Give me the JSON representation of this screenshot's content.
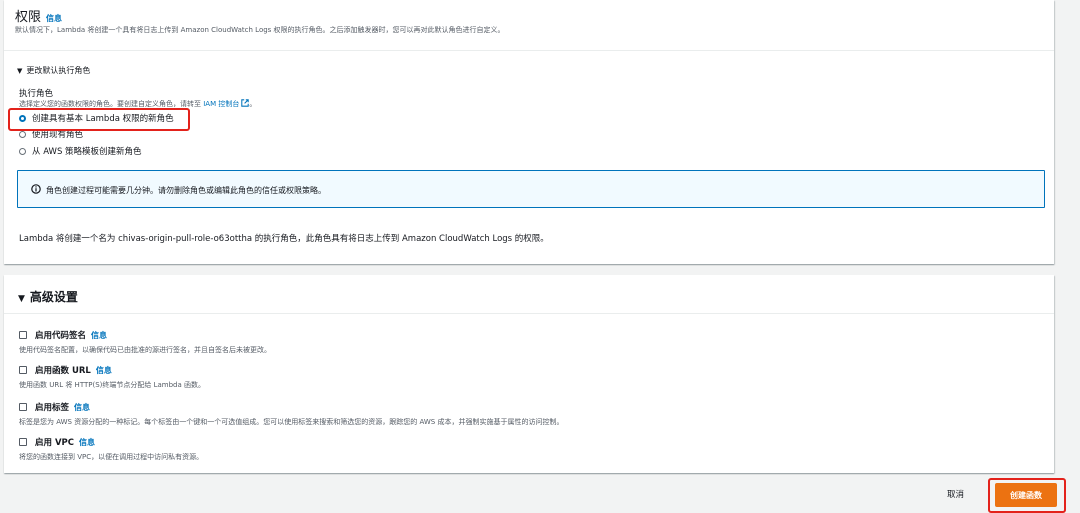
{
  "permissions": {
    "title": "权限",
    "info": "信息",
    "description": "默认情况下，Lambda 将创建一个具有将日志上传到 Amazon CloudWatch Logs 权限的执行角色。之后添加触发器时，您可以再对此默认角色进行自定义。",
    "change_role_toggle": "更改默认执行角色",
    "exec_role_label": "执行角色",
    "exec_role_desc": "选择定义您的函数权限的角色。要创建自定义角色，请转至",
    "iam_link": "IAM 控制台",
    "period": "。",
    "options": [
      {
        "label": "创建具有基本 Lambda 权限的新角色",
        "selected": true
      },
      {
        "label": "使用现有角色",
        "selected": false
      },
      {
        "label": "从 AWS 策略模板创建新角色",
        "selected": false
      }
    ],
    "alert": "角色创建过程可能需要几分钟。请勿删除角色或编辑此角色的信任或权限策略。",
    "note": "Lambda 将创建一个名为 chivas-origin-pull-role-o63ottha 的执行角色，此角色具有将日志上传到 Amazon CloudWatch Logs 的权限。"
  },
  "advanced": {
    "title": "高级设置",
    "items": [
      {
        "label": "启用代码签名",
        "info": "信息",
        "desc": "使用代码签名配置，以确保代码已由批准的源进行签名，并且自签名后未被更改。",
        "checked": false
      },
      {
        "label": "启用函数 URL",
        "info": "信息",
        "desc": "使用函数 URL 将 HTTP(S)终端节点分配给 Lambda 函数。",
        "checked": false
      },
      {
        "label": "启用标签",
        "info": "信息",
        "desc": "标签是您为 AWS 资源分配的一种标记。每个标签由一个键和一个可选值组成。您可以使用标签来搜索和筛选您的资源，跟踪您的 AWS 成本，并强制实施基于属性的访问控制。",
        "checked": false
      },
      {
        "label": "启用 VPC",
        "info": "信息",
        "desc": "将您的函数连接到 VPC，以便在调用过程中访问私有资源。",
        "checked": false
      }
    ]
  },
  "footer": {
    "cancel": "取消",
    "create": "创建函数"
  },
  "colors": {
    "accent": "#0073bb",
    "primary_button": "#ec7211",
    "highlight_box": "#e3221b"
  }
}
